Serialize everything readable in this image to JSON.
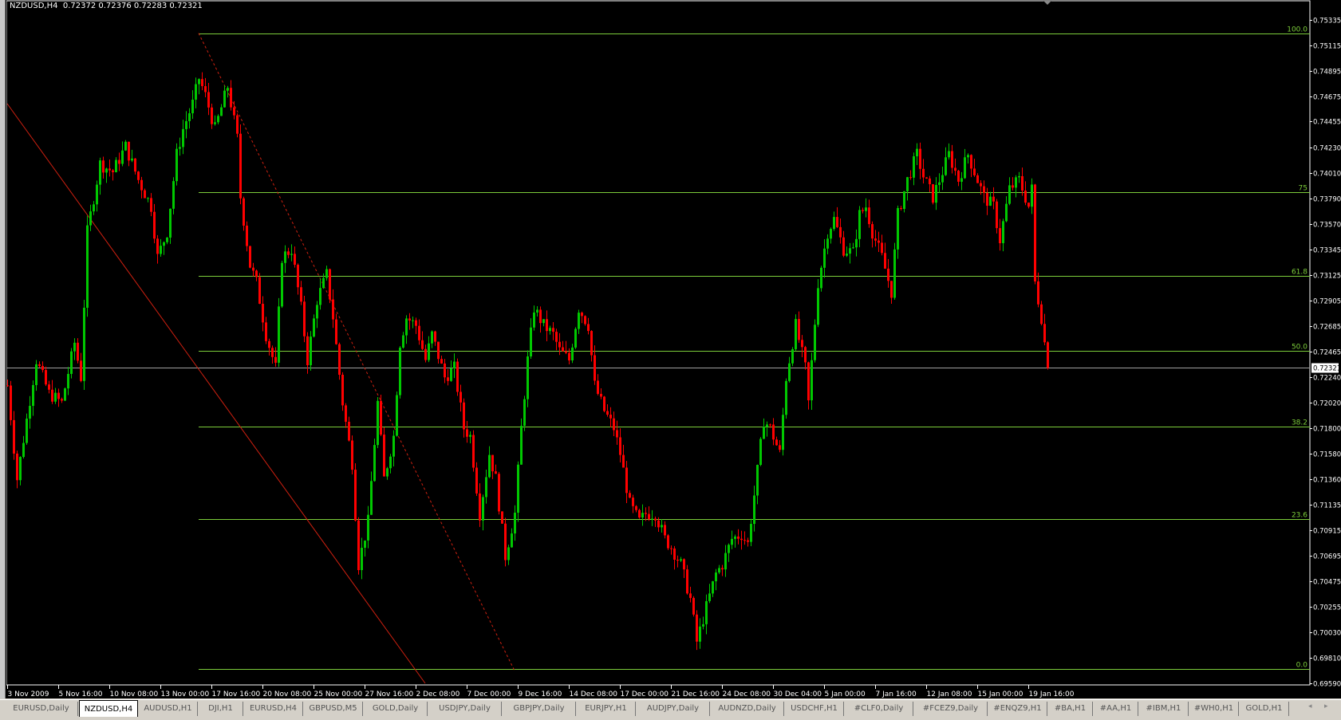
{
  "header": {
    "symbol": "NZDUSD,H4",
    "ohlc": "0.72372 0.72376 0.72283 0.72321"
  },
  "tabs": [
    "EURUSD,Daily",
    "NZDUSD,H4",
    "AUDUSD,H1",
    "DJI,H1",
    "EURUSD,H4",
    "GBPUSD,M5",
    "GOLD,Daily",
    "USDJPY,Daily",
    "GBPJPY,Daily",
    "EURJPY,H1",
    "AUDJPY,Daily",
    "AUDNZD,Daily",
    "USDCHF,H1",
    "#CLF0,Daily",
    "#FCEZ9,Daily",
    "#ENQZ9,H1",
    "#BA,H1",
    "#AA,H1",
    "#IBM,H1",
    "#WH0,H1",
    "GOLD,H1"
  ],
  "active_tab": 1,
  "colors": {
    "bull": "#00c800",
    "bear": "#ff0000",
    "fib": "#7ccd3a",
    "trend": "#d02010",
    "grid": "#ffffff"
  },
  "chart_data": {
    "type": "candlestick",
    "title": "NZDUSD,H4",
    "ylim": [
      0.6959,
      0.75335
    ],
    "price_ticks": [
      "0.75335",
      "0.75115",
      "0.74895",
      "0.74675",
      "0.74455",
      "0.74230",
      "0.74010",
      "0.73790",
      "0.73570",
      "0.73345",
      "0.73125",
      "0.72905",
      "0.72685",
      "0.72465",
      "0.72240",
      "0.72020",
      "0.71800",
      "0.71580",
      "0.71360",
      "0.71135",
      "0.70915",
      "0.70695",
      "0.70475",
      "0.70255",
      "0.70030",
      "0.69810",
      "0.69590"
    ],
    "current_price": "0.72321",
    "time_labels": [
      "3 Nov 2009",
      "5 Nov 16:00",
      "10 Nov 08:00",
      "13 Nov 00:00",
      "17 Nov 16:00",
      "20 Nov 08:00",
      "25 Nov 00:00",
      "27 Nov 16:00",
      "2 Dec 08:00",
      "7 Dec 00:00",
      "9 Dec 16:00",
      "14 Dec 08:00",
      "17 Dec 00:00",
      "21 Dec 16:00",
      "24 Dec 08:00",
      "30 Dec 04:00",
      "5 Jan 00:00",
      "7 Jan 16:00",
      "12 Jan 08:00",
      "15 Jan 00:00",
      "19 Jan 16:00"
    ],
    "bars_per_label": 16,
    "fibonacci": {
      "high": 0.75218,
      "low": 0.69714,
      "start_bar": 60,
      "levels": [
        {
          "pct": 100,
          "label": "100.0"
        },
        {
          "pct": 75,
          "label": "75"
        },
        {
          "pct": 61.8,
          "label": "61.8"
        },
        {
          "pct": 50,
          "label": "50.0"
        },
        {
          "pct": 38.2,
          "label": "38.2"
        },
        {
          "pct": 23.6,
          "label": "23.6"
        },
        {
          "pct": 0,
          "label": "0.0"
        }
      ]
    },
    "trendlines": [
      {
        "style": "solid",
        "from": [
          0,
          0.7461
        ],
        "to": [
          131,
          0.6959
        ]
      },
      {
        "style": "dashed",
        "from": [
          60,
          0.7522
        ],
        "to": [
          159,
          0.697
        ]
      }
    ],
    "close_keypoints": [
      [
        0,
        0.7217
      ],
      [
        3,
        0.7136
      ],
      [
        9,
        0.7239
      ],
      [
        13,
        0.721
      ],
      [
        17,
        0.7202
      ],
      [
        21,
        0.7254
      ],
      [
        23,
        0.7224
      ],
      [
        25,
        0.735
      ],
      [
        29,
        0.7409
      ],
      [
        33,
        0.7402
      ],
      [
        37,
        0.7424
      ],
      [
        41,
        0.7395
      ],
      [
        45,
        0.7372
      ],
      [
        47,
        0.7328
      ],
      [
        50,
        0.735
      ],
      [
        53,
        0.7417
      ],
      [
        55,
        0.7439
      ],
      [
        58,
        0.7461
      ],
      [
        60,
        0.7483
      ],
      [
        62,
        0.7468
      ],
      [
        65,
        0.7439
      ],
      [
        69,
        0.7476
      ],
      [
        72,
        0.7431
      ],
      [
        73,
        0.738
      ],
      [
        76,
        0.7321
      ],
      [
        78,
        0.7306
      ],
      [
        81,
        0.7261
      ],
      [
        84,
        0.7232
      ],
      [
        86,
        0.7328
      ],
      [
        89,
        0.7335
      ],
      [
        92,
        0.7284
      ],
      [
        94,
        0.7239
      ],
      [
        97,
        0.7291
      ],
      [
        100,
        0.7313
      ],
      [
        102,
        0.7276
      ],
      [
        105,
        0.7202
      ],
      [
        108,
        0.715
      ],
      [
        110,
        0.7062
      ],
      [
        113,
        0.7099
      ],
      [
        116,
        0.7202
      ],
      [
        118,
        0.7136
      ],
      [
        121,
        0.7173
      ],
      [
        123,
        0.7254
      ],
      [
        125,
        0.7276
      ],
      [
        128,
        0.7269
      ],
      [
        131,
        0.7239
      ],
      [
        133,
        0.7261
      ],
      [
        137,
        0.7224
      ],
      [
        140,
        0.7232
      ],
      [
        143,
        0.718
      ],
      [
        145,
        0.7173
      ],
      [
        148,
        0.7106
      ],
      [
        151,
        0.7158
      ],
      [
        153,
        0.7136
      ],
      [
        156,
        0.7069
      ],
      [
        159,
        0.7106
      ],
      [
        161,
        0.718
      ],
      [
        163,
        0.7239
      ],
      [
        165,
        0.7284
      ],
      [
        168,
        0.7269
      ],
      [
        171,
        0.7261
      ],
      [
        173,
        0.7247
      ],
      [
        176,
        0.7239
      ],
      [
        179,
        0.7284
      ],
      [
        182,
        0.7269
      ],
      [
        184,
        0.7217
      ],
      [
        187,
        0.7195
      ],
      [
        190,
        0.718
      ],
      [
        192,
        0.7158
      ],
      [
        195,
        0.7114
      ],
      [
        198,
        0.7099
      ],
      [
        200,
        0.7106
      ],
      [
        203,
        0.7106
      ],
      [
        206,
        0.7084
      ],
      [
        208,
        0.7077
      ],
      [
        211,
        0.7062
      ],
      [
        214,
        0.7032
      ],
      [
        216,
        0.6995
      ],
      [
        219,
        0.7025
      ],
      [
        222,
        0.7054
      ],
      [
        224,
        0.7062
      ],
      [
        227,
        0.7084
      ],
      [
        230,
        0.7088
      ],
      [
        232,
        0.708
      ],
      [
        235,
        0.7143
      ],
      [
        237,
        0.7187
      ],
      [
        239,
        0.718
      ],
      [
        242,
        0.7158
      ],
      [
        244,
        0.7224
      ],
      [
        247,
        0.7269
      ],
      [
        250,
        0.7232
      ],
      [
        251,
        0.7202
      ],
      [
        254,
        0.7306
      ],
      [
        257,
        0.735
      ],
      [
        259,
        0.7361
      ],
      [
        262,
        0.7335
      ],
      [
        265,
        0.7332
      ],
      [
        267,
        0.7365
      ],
      [
        269,
        0.7372
      ],
      [
        271,
        0.735
      ],
      [
        274,
        0.7328
      ],
      [
        277,
        0.7298
      ],
      [
        279,
        0.7365
      ],
      [
        282,
        0.7395
      ],
      [
        285,
        0.7417
      ],
      [
        287,
        0.7398
      ],
      [
        290,
        0.738
      ],
      [
        293,
        0.7402
      ],
      [
        295,
        0.7417
      ],
      [
        298,
        0.7395
      ],
      [
        301,
        0.7417
      ],
      [
        303,
        0.7402
      ],
      [
        306,
        0.738
      ],
      [
        309,
        0.7372
      ],
      [
        311,
        0.7343
      ],
      [
        314,
        0.7387
      ],
      [
        317,
        0.7395
      ],
      [
        320,
        0.7372
      ],
      [
        321,
        0.7387
      ],
      [
        322,
        0.7306
      ],
      [
        324,
        0.7276
      ],
      [
        326,
        0.72321
      ]
    ]
  }
}
